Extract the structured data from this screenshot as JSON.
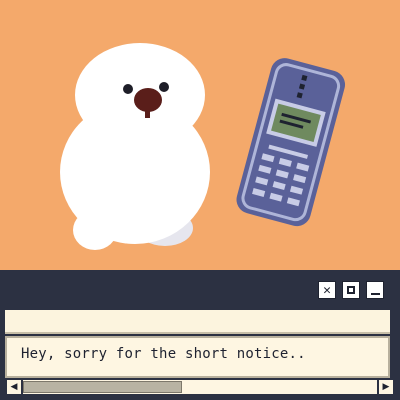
{
  "dialog": {
    "text": "Hey, sorry for the short notice..",
    "window_controls": {
      "close_glyph": "✕"
    },
    "scroll": {
      "left_arrow": "◀",
      "right_arrow": "▶",
      "position_fraction": 0.0,
      "visible_fraction": 0.45
    }
  },
  "scene": {
    "character": "white-seal-character",
    "prop": "retro-cell-phone",
    "colors": {
      "background": "#f4a96b",
      "character_body": "#ffffff",
      "character_nose": "#5a1e1a",
      "phone_body": "#5a6199",
      "phone_screen": "#6f8a5f"
    }
  }
}
